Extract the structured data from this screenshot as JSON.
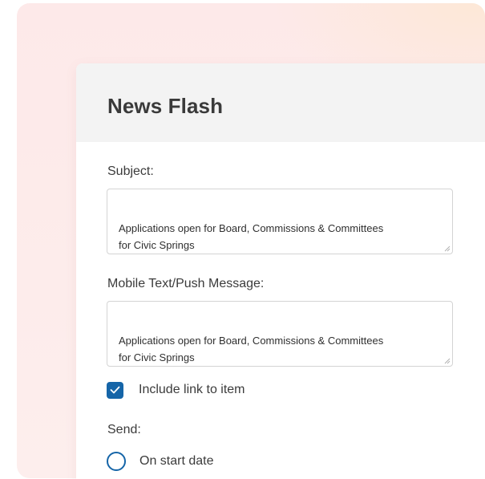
{
  "dialog": {
    "title": "News Flash"
  },
  "subject": {
    "label": "Subject:",
    "value": "Applications open for Board, Commissions & Committees\nfor Civic Springs"
  },
  "mobile_message": {
    "label": "Mobile Text/Push Message:",
    "value": "Applications open for Board, Commissions & Committees\nfor Civic Springs"
  },
  "include_link": {
    "label": "Include link to item",
    "checked": true
  },
  "send": {
    "label": "Send:",
    "options": [
      {
        "label": "On start date",
        "selected": false
      }
    ]
  },
  "colors": {
    "accent": "#1565a8",
    "header_bg": "#f3f3f3",
    "background_pink": "#fde9e9",
    "background_peach": "#fde8d6"
  }
}
